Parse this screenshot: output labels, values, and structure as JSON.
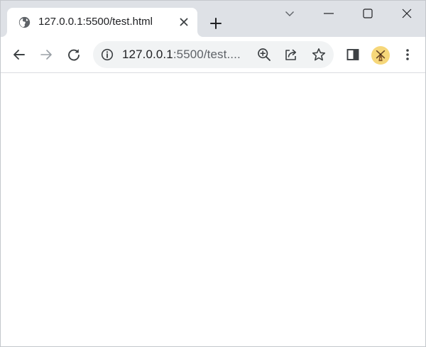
{
  "tab": {
    "title": "127.0.0.1:5500/test.html",
    "favicon": "globe-icon",
    "close_icon": "close-icon"
  },
  "tabstrip": {
    "new_tab_icon": "plus-icon",
    "tab_search_icon": "chevron-down-icon"
  },
  "window_controls": [
    "minimize-icon",
    "maximize-icon",
    "close-icon"
  ],
  "toolbar": {
    "back_icon": "arrow-left-icon",
    "forward_icon": "arrow-right-icon",
    "reload_icon": "reload-icon",
    "side_panel_icon": "side-panel-icon",
    "menu_icon": "kebab-menu-icon"
  },
  "omnibox": {
    "site_info_icon": "info-icon",
    "url_host": "127.0.0.1",
    "url_rest": ":5500/test....",
    "zoom_icon": "zoom-in-icon",
    "share_icon": "share-icon",
    "bookmark_icon": "star-icon"
  },
  "profile": {
    "avatar_icon": "windmill-avatar-icon"
  },
  "colors": {
    "tabstrip_bg": "#dee1e6",
    "omnibox_bg": "#f1f3f4",
    "icon": "#3c4043",
    "disabled_icon": "#9aa0a6",
    "avatar_bg": "#f6d77a"
  }
}
